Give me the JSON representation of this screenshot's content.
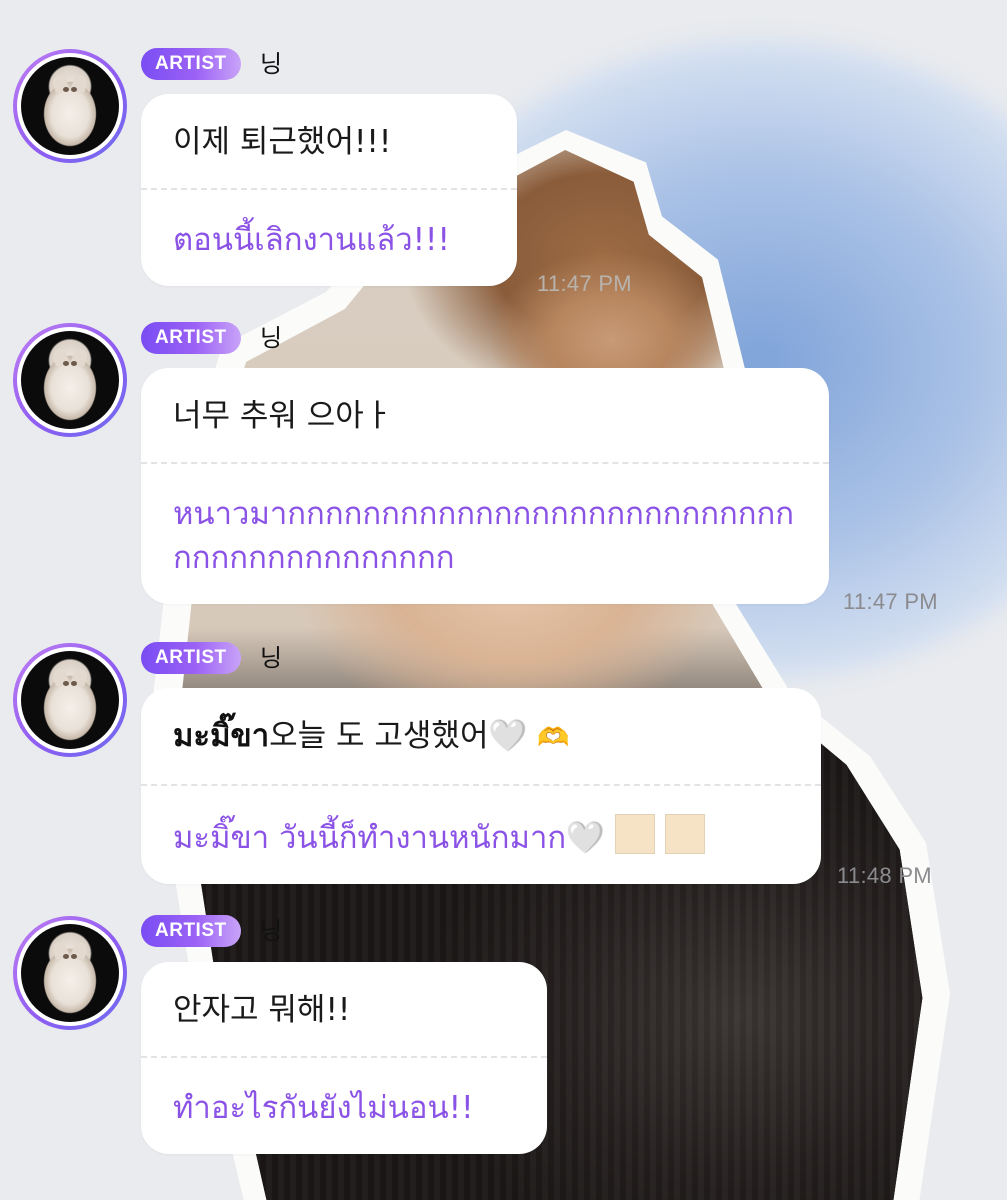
{
  "colors": {
    "badge_gradient_start": "#7a4df3",
    "badge_gradient_end": "#c9a3f8",
    "translation_text": "#8b52e6",
    "bubble_bg": "#ffffff",
    "timestamp": "#8b8b8f"
  },
  "messages": [
    {
      "badge": "ARTIST",
      "sender": "닝",
      "avatar_icon": "white-cat-avatar",
      "original": "이제 퇴근했어!!!",
      "translation": "ตอนนี้เลิกงานแล้ว!!!",
      "time": "11:47 PM"
    },
    {
      "badge": "ARTIST",
      "sender": "닝",
      "avatar_icon": "white-cat-avatar",
      "original": "너무 추워 으아ㅏ",
      "translation": "หนาวมากกกกกกกกกกกกกกกกกกกกกกกกกกกกกกกกกกกกกกกกกก",
      "time": "11:47 PM"
    },
    {
      "badge": "ARTIST",
      "sender": "닝",
      "avatar_icon": "white-cat-avatar",
      "original_bold": "มะมิ๊ขา",
      "original": "오늘 도 고생했어",
      "original_emoji_1": "🤍",
      "original_emoji_2": "🫶",
      "translation": "มะมิ๊ขา วันนี้ก็ทำงานหนักมาก",
      "translation_emoji": "🤍",
      "time": "11:48 PM"
    },
    {
      "badge": "ARTIST",
      "sender": "닝",
      "avatar_icon": "white-cat-avatar",
      "original": "안자고 뭐해!!",
      "translation": "ทำอะไรกันยังไม่นอน!!"
    }
  ]
}
